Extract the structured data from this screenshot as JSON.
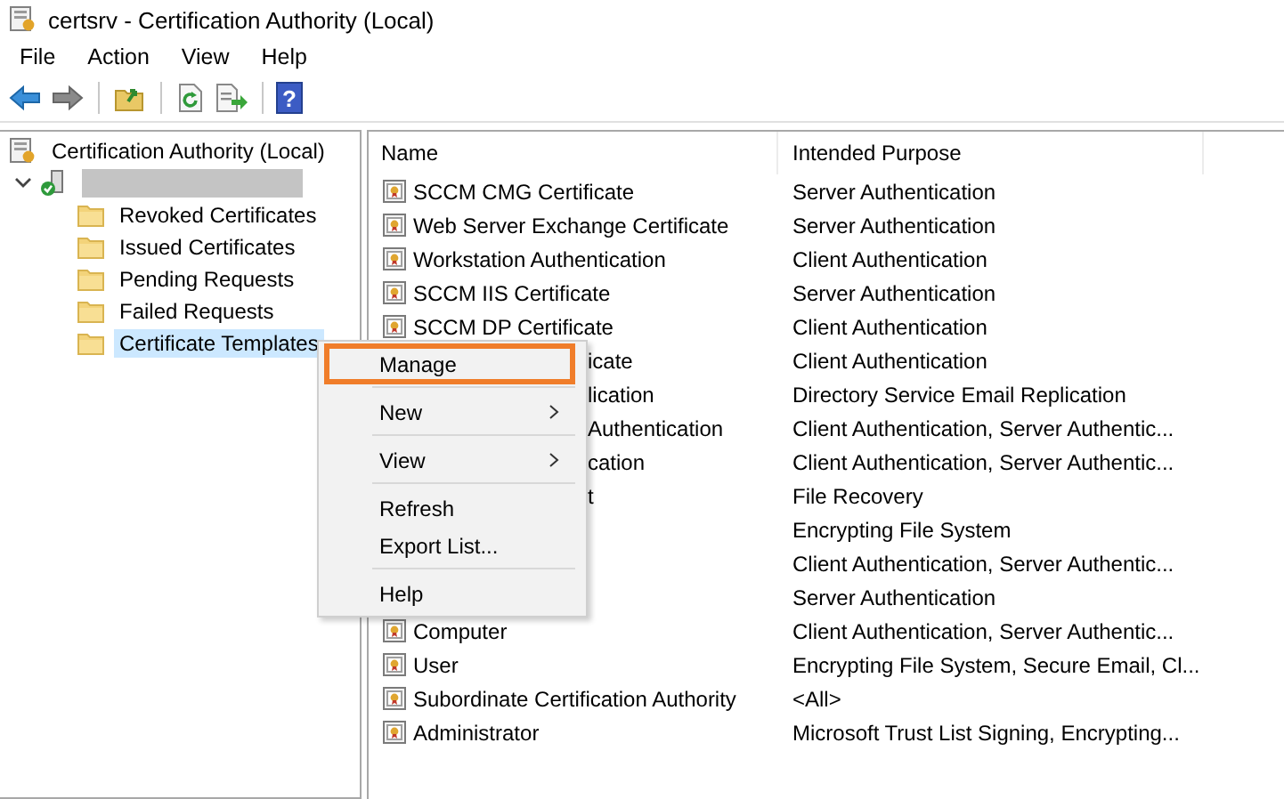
{
  "window": {
    "title": "certsrv -  Certification Authority (Local)"
  },
  "menu_bar": [
    "File",
    "Action",
    "View",
    "Help"
  ],
  "toolbar": [
    {
      "kind": "back"
    },
    {
      "kind": "forward"
    },
    {
      "kind": "separator"
    },
    {
      "kind": "up"
    },
    {
      "kind": "separator"
    },
    {
      "kind": "refresh"
    },
    {
      "kind": "export"
    },
    {
      "kind": "separator"
    },
    {
      "kind": "help",
      "label": "?"
    }
  ],
  "tree": {
    "label": "Certification Authority (Local)",
    "children": [
      {
        "kind": "server",
        "redacted": true,
        "expanded": true,
        "children": [
          {
            "label": "Revoked Certificates",
            "selected": false
          },
          {
            "label": "Issued Certificates",
            "selected": false
          },
          {
            "label": "Pending Requests",
            "selected": false
          },
          {
            "label": "Failed Requests",
            "selected": false
          },
          {
            "label": "Certificate Templates",
            "selected": true
          }
        ]
      }
    ]
  },
  "list": {
    "columns": [
      "Name",
      "Intended Purpose"
    ],
    "rows": [
      {
        "name": "SCCM CMG Certificate",
        "purpose": "Server Authentication",
        "covered": false
      },
      {
        "name": "Web Server Exchange Certificate",
        "purpose": "Server Authentication",
        "covered": false
      },
      {
        "name": "Workstation Authentication",
        "purpose": "Client Authentication",
        "covered": false
      },
      {
        "name": "SCCM IIS Certificate",
        "purpose": "Server Authentication",
        "covered": false
      },
      {
        "name": "SCCM DP Certificate",
        "purpose": "Client Authentication",
        "covered": false
      },
      {
        "name": "icate",
        "purpose": "Client Authentication",
        "covered": true
      },
      {
        "name": "lication",
        "purpose": "Directory Service Email Replication",
        "covered": true
      },
      {
        "name": "Authentication",
        "purpose": "Client Authentication, Server Authentic...",
        "covered": true
      },
      {
        "name": "cation",
        "purpose": "Client Authentication, Server Authentic...",
        "covered": true
      },
      {
        "name": "t",
        "purpose": "File Recovery",
        "covered": true
      },
      {
        "purpose": "Encrypting File System"
      },
      {
        "purpose": "Client Authentication, Server Authentic..."
      },
      {
        "purpose": "Server Authentication"
      },
      {
        "name": "Computer",
        "purpose": "Client Authentication, Server Authentic...",
        "covered": false
      },
      {
        "name": "User",
        "purpose": "Encrypting File System, Secure Email, Cl...",
        "covered": false
      },
      {
        "name": "Subordinate Certification Authority",
        "purpose": "<All>",
        "covered": false
      },
      {
        "name": "Administrator",
        "purpose": "Microsoft Trust List Signing, Encrypting...",
        "covered": false
      }
    ]
  },
  "context_menu": [
    {
      "kind": "item",
      "label": "Manage",
      "submenu": false,
      "highlighted": true
    },
    {
      "kind": "separator"
    },
    {
      "kind": "item",
      "label": "New",
      "submenu": true,
      "highlighted": false
    },
    {
      "kind": "separator"
    },
    {
      "kind": "item",
      "label": "View",
      "submenu": true,
      "highlighted": false
    },
    {
      "kind": "separator"
    },
    {
      "kind": "item",
      "label": "Refresh",
      "submenu": false,
      "highlighted": false
    },
    {
      "kind": "item",
      "label": "Export List...",
      "submenu": false,
      "highlighted": false
    },
    {
      "kind": "separator"
    },
    {
      "kind": "item",
      "label": "Help",
      "submenu": false,
      "highlighted": false
    }
  ]
}
